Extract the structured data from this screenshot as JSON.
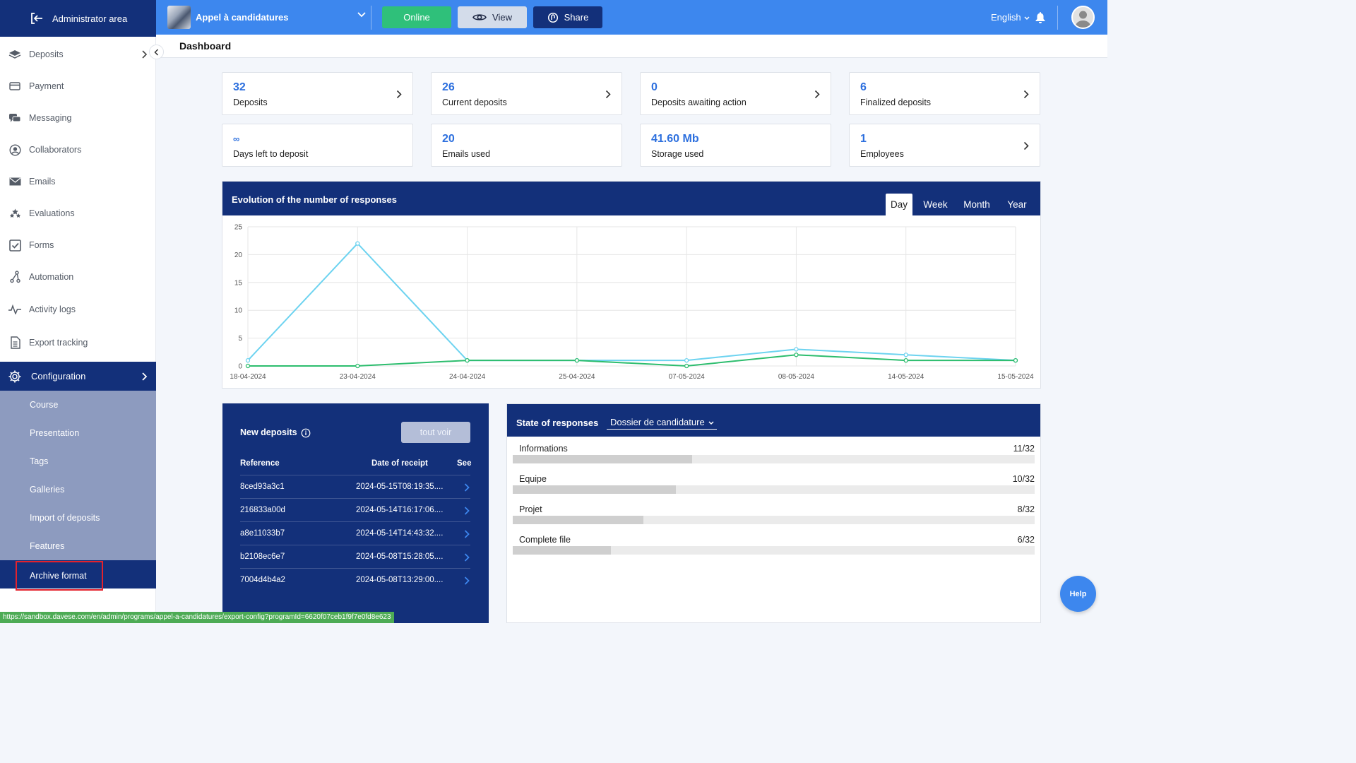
{
  "topbar": {
    "admin_label": "Administrator area",
    "program_name": "Appel à candidatures",
    "online_label": "Online",
    "view_label": "View",
    "share_label": "Share",
    "language": "English",
    "colors": {
      "topbar": "#3d87ee",
      "navy": "#13307a",
      "online": "#2fc07a",
      "view": "#d3dcea"
    }
  },
  "sidebar": {
    "items": [
      {
        "label": "Deposits",
        "icon": "layers-icon"
      },
      {
        "label": "Payment",
        "icon": "credit-card-icon"
      },
      {
        "label": "Messaging",
        "icon": "chat-bubbles-icon"
      },
      {
        "label": "Collaborators",
        "icon": "user-circle-icon"
      },
      {
        "label": "Emails",
        "icon": "envelope-icon"
      },
      {
        "label": "Evaluations",
        "icon": "stars-icon"
      },
      {
        "label": "Forms",
        "icon": "checkbox-icon"
      },
      {
        "label": "Automation",
        "icon": "flow-icon"
      },
      {
        "label": "Activity logs",
        "icon": "activity-icon"
      },
      {
        "label": "Export tracking",
        "icon": "document-icon"
      }
    ],
    "configuration_label": "Configuration",
    "sub_items": [
      "Course",
      "Presentation",
      "Tags",
      "Galleries",
      "Import of deposits",
      "Features"
    ],
    "active_sub_item": "Archive format"
  },
  "page_title": "Dashboard",
  "stats": [
    {
      "value": "32",
      "label": "Deposits",
      "has_arrow": true
    },
    {
      "value": "26",
      "label": "Current deposits",
      "has_arrow": true
    },
    {
      "value": "0",
      "label": "Deposits awaiting action",
      "has_arrow": true
    },
    {
      "value": "6",
      "label": "Finalized deposits",
      "has_arrow": true
    },
    {
      "value": "∞",
      "label": "Days left to deposit",
      "has_arrow": false
    },
    {
      "value": "20",
      "label": "Emails used",
      "has_arrow": false
    },
    {
      "value": "41.60 Mb",
      "label": "Storage used",
      "has_arrow": false
    },
    {
      "value": "1",
      "label": "Employees",
      "has_arrow": true
    }
  ],
  "chart_panel": {
    "title": "Evolution of the number of responses",
    "tabs": [
      "Day",
      "Week",
      "Month",
      "Year"
    ],
    "active_tab": "Day"
  },
  "chart_data": {
    "type": "line",
    "x": [
      "18-04-2024",
      "23-04-2024",
      "24-04-2024",
      "25-04-2024",
      "07-05-2024",
      "08-05-2024",
      "14-05-2024",
      "15-05-2024"
    ],
    "yticks": [
      "0",
      "5",
      "10",
      "15",
      "20",
      "25"
    ],
    "ylim": [
      0,
      25
    ],
    "series": [
      {
        "color": "#6dd3f0",
        "values": [
          1,
          22,
          1,
          1,
          1,
          3,
          2,
          1
        ]
      },
      {
        "color": "#2dbd6e",
        "values": [
          0,
          0,
          1,
          1,
          0,
          2,
          1,
          1
        ]
      }
    ],
    "grid": true
  },
  "new_deposits": {
    "title": "New deposits",
    "see_all": "tout voir",
    "columns": [
      "Reference",
      "Date of receipt",
      "See"
    ],
    "rows": [
      {
        "ref": "8ced93a3c1",
        "date": "2024-05-15T08:19:35...."
      },
      {
        "ref": "216833a00d",
        "date": "2024-05-14T16:17:06...."
      },
      {
        "ref": "a8e11033b7",
        "date": "2024-05-14T14:43:32...."
      },
      {
        "ref": "b2108ec6e7",
        "date": "2024-05-08T15:28:05...."
      },
      {
        "ref": "7004d4b4a2",
        "date": "2024-05-08T13:29:00...."
      }
    ]
  },
  "state_of_responses": {
    "title": "State of responses",
    "selected_form": "Dossier de candidature",
    "rows": [
      {
        "label": "Informations",
        "count": "11/32",
        "fraction": 0.34375
      },
      {
        "label": "Equipe",
        "count": "10/32",
        "fraction": 0.3125
      },
      {
        "label": "Projet",
        "count": "8/32",
        "fraction": 0.25
      },
      {
        "label": "Complete file",
        "count": "6/32",
        "fraction": 0.1875
      }
    ]
  },
  "help_label": "Help",
  "status_url": "https://sandbox.davese.com/en/admin/programs/appel-a-candidatures/export-config?programId=6620f07ceb1f9f7e0fd8e623"
}
